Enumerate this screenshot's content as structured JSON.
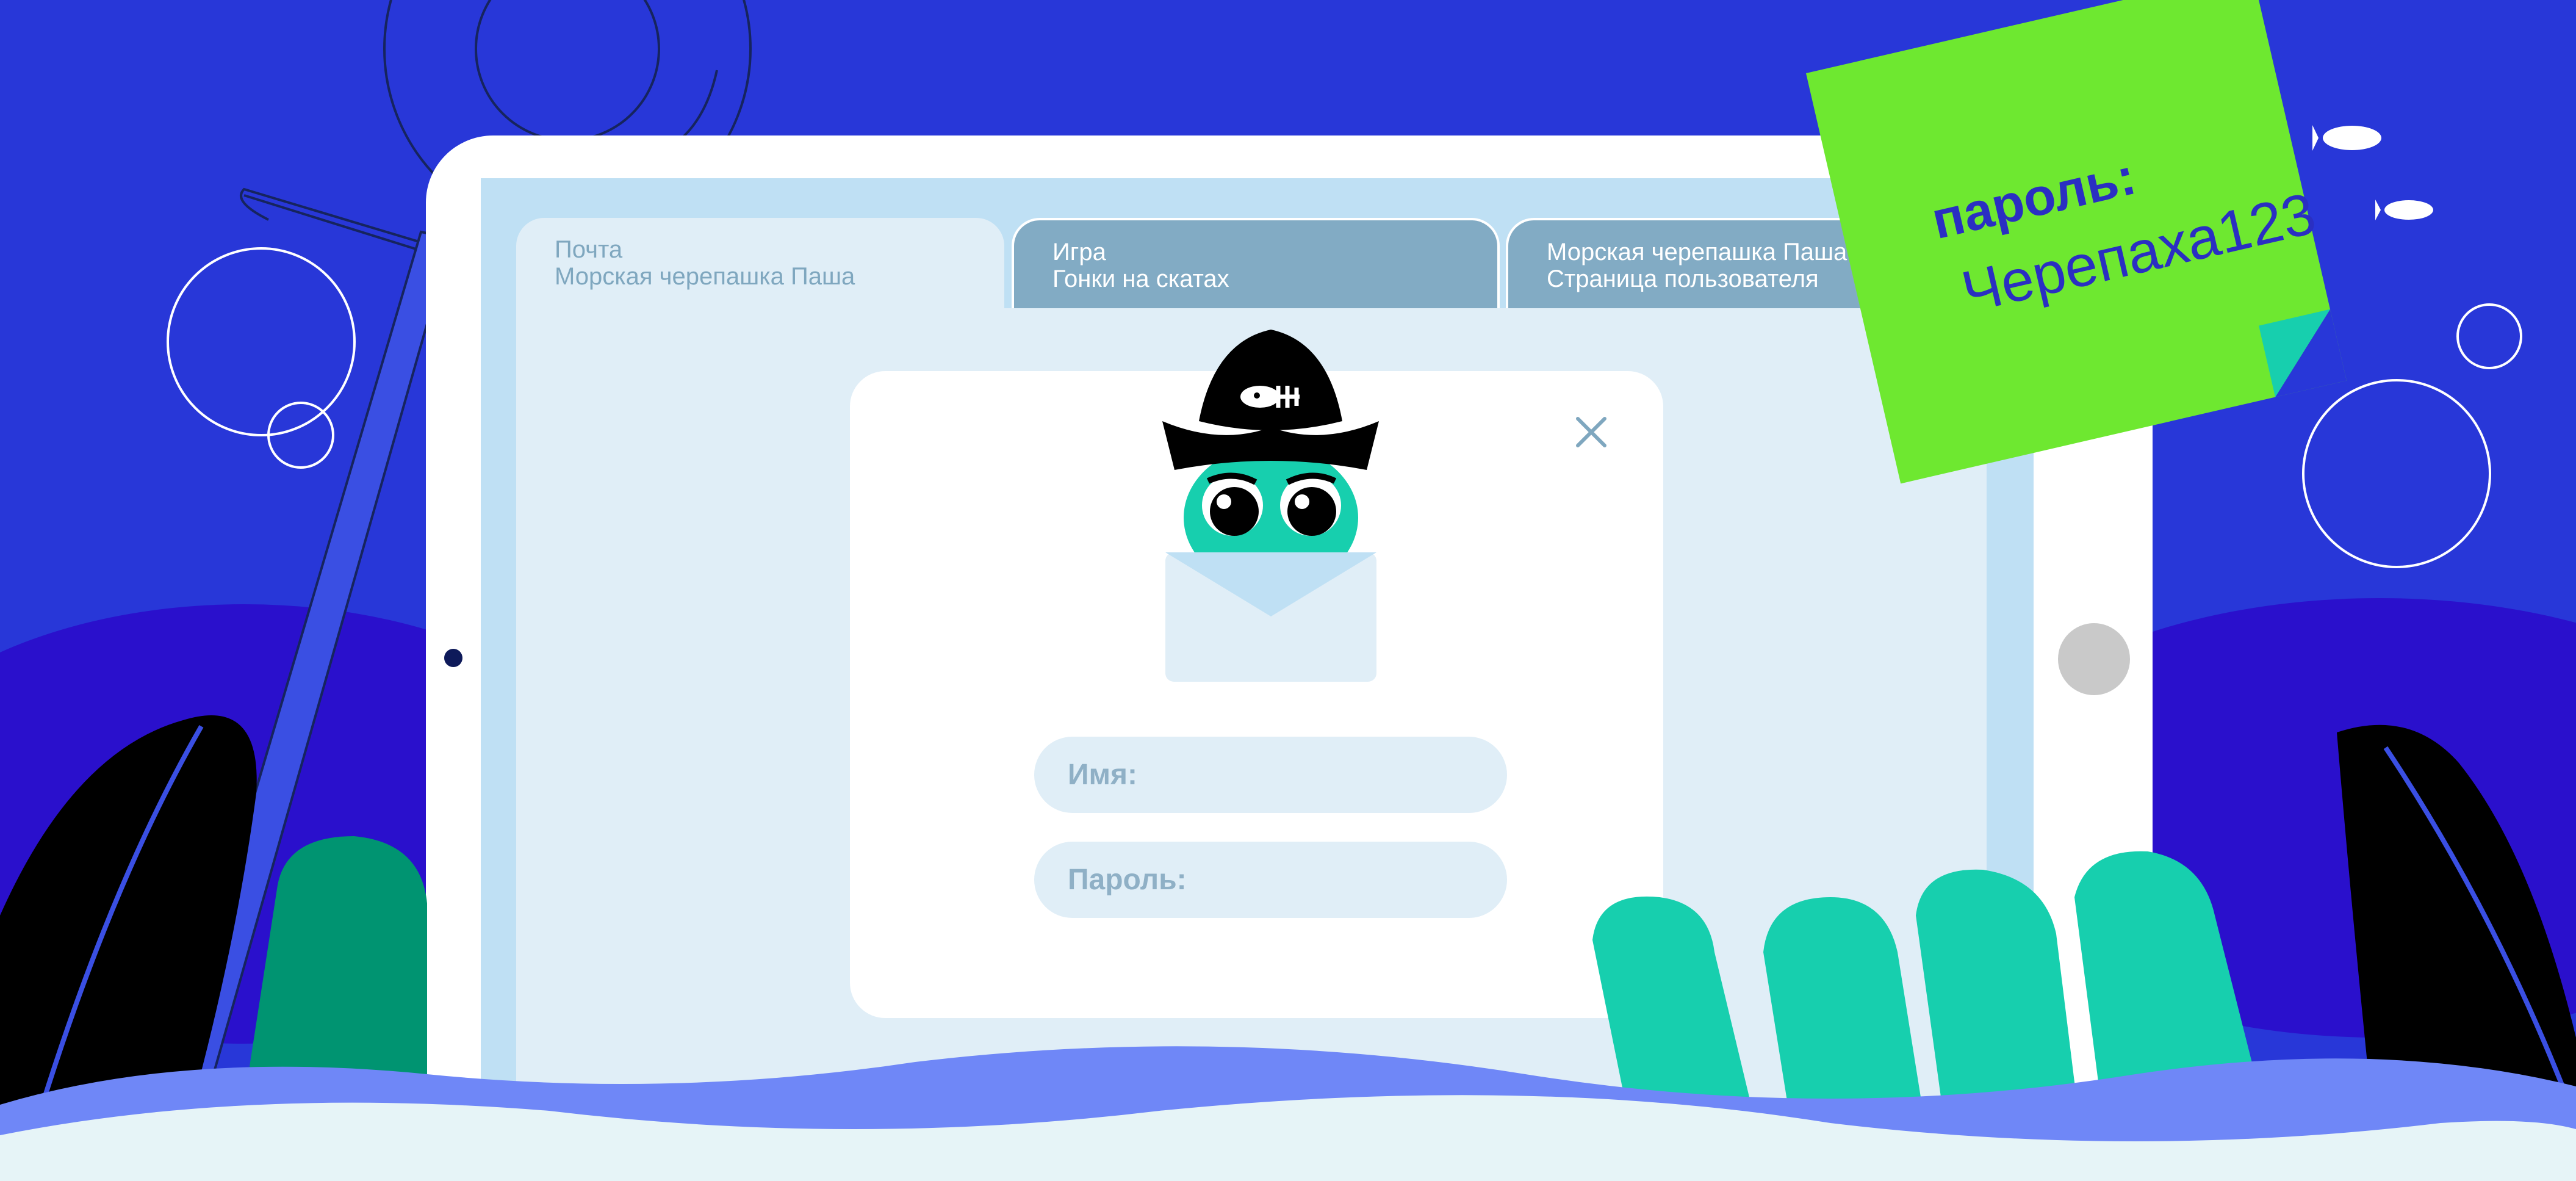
{
  "browser": {
    "tabs": [
      {
        "line1": "Почта",
        "line2": "Морская черепашка Паша"
      },
      {
        "line1": "Игра",
        "line2": "Гонки на скатах"
      },
      {
        "line1": "Морская черепашка Паша",
        "line2": "Страница пользователя"
      }
    ]
  },
  "login": {
    "name_placeholder": "Имя:",
    "password_placeholder": "Пароль:"
  },
  "sticky_note": {
    "label": "пароль:",
    "value": "Черепаха123"
  },
  "colors": {
    "background": "#2837d8",
    "note": "#6ee830",
    "accent_teal": "#17cfae",
    "wave": "#6f87f7"
  },
  "icons": [
    "pirate-hat-icon",
    "envelope-icon",
    "close-icon",
    "fish-icon"
  ]
}
